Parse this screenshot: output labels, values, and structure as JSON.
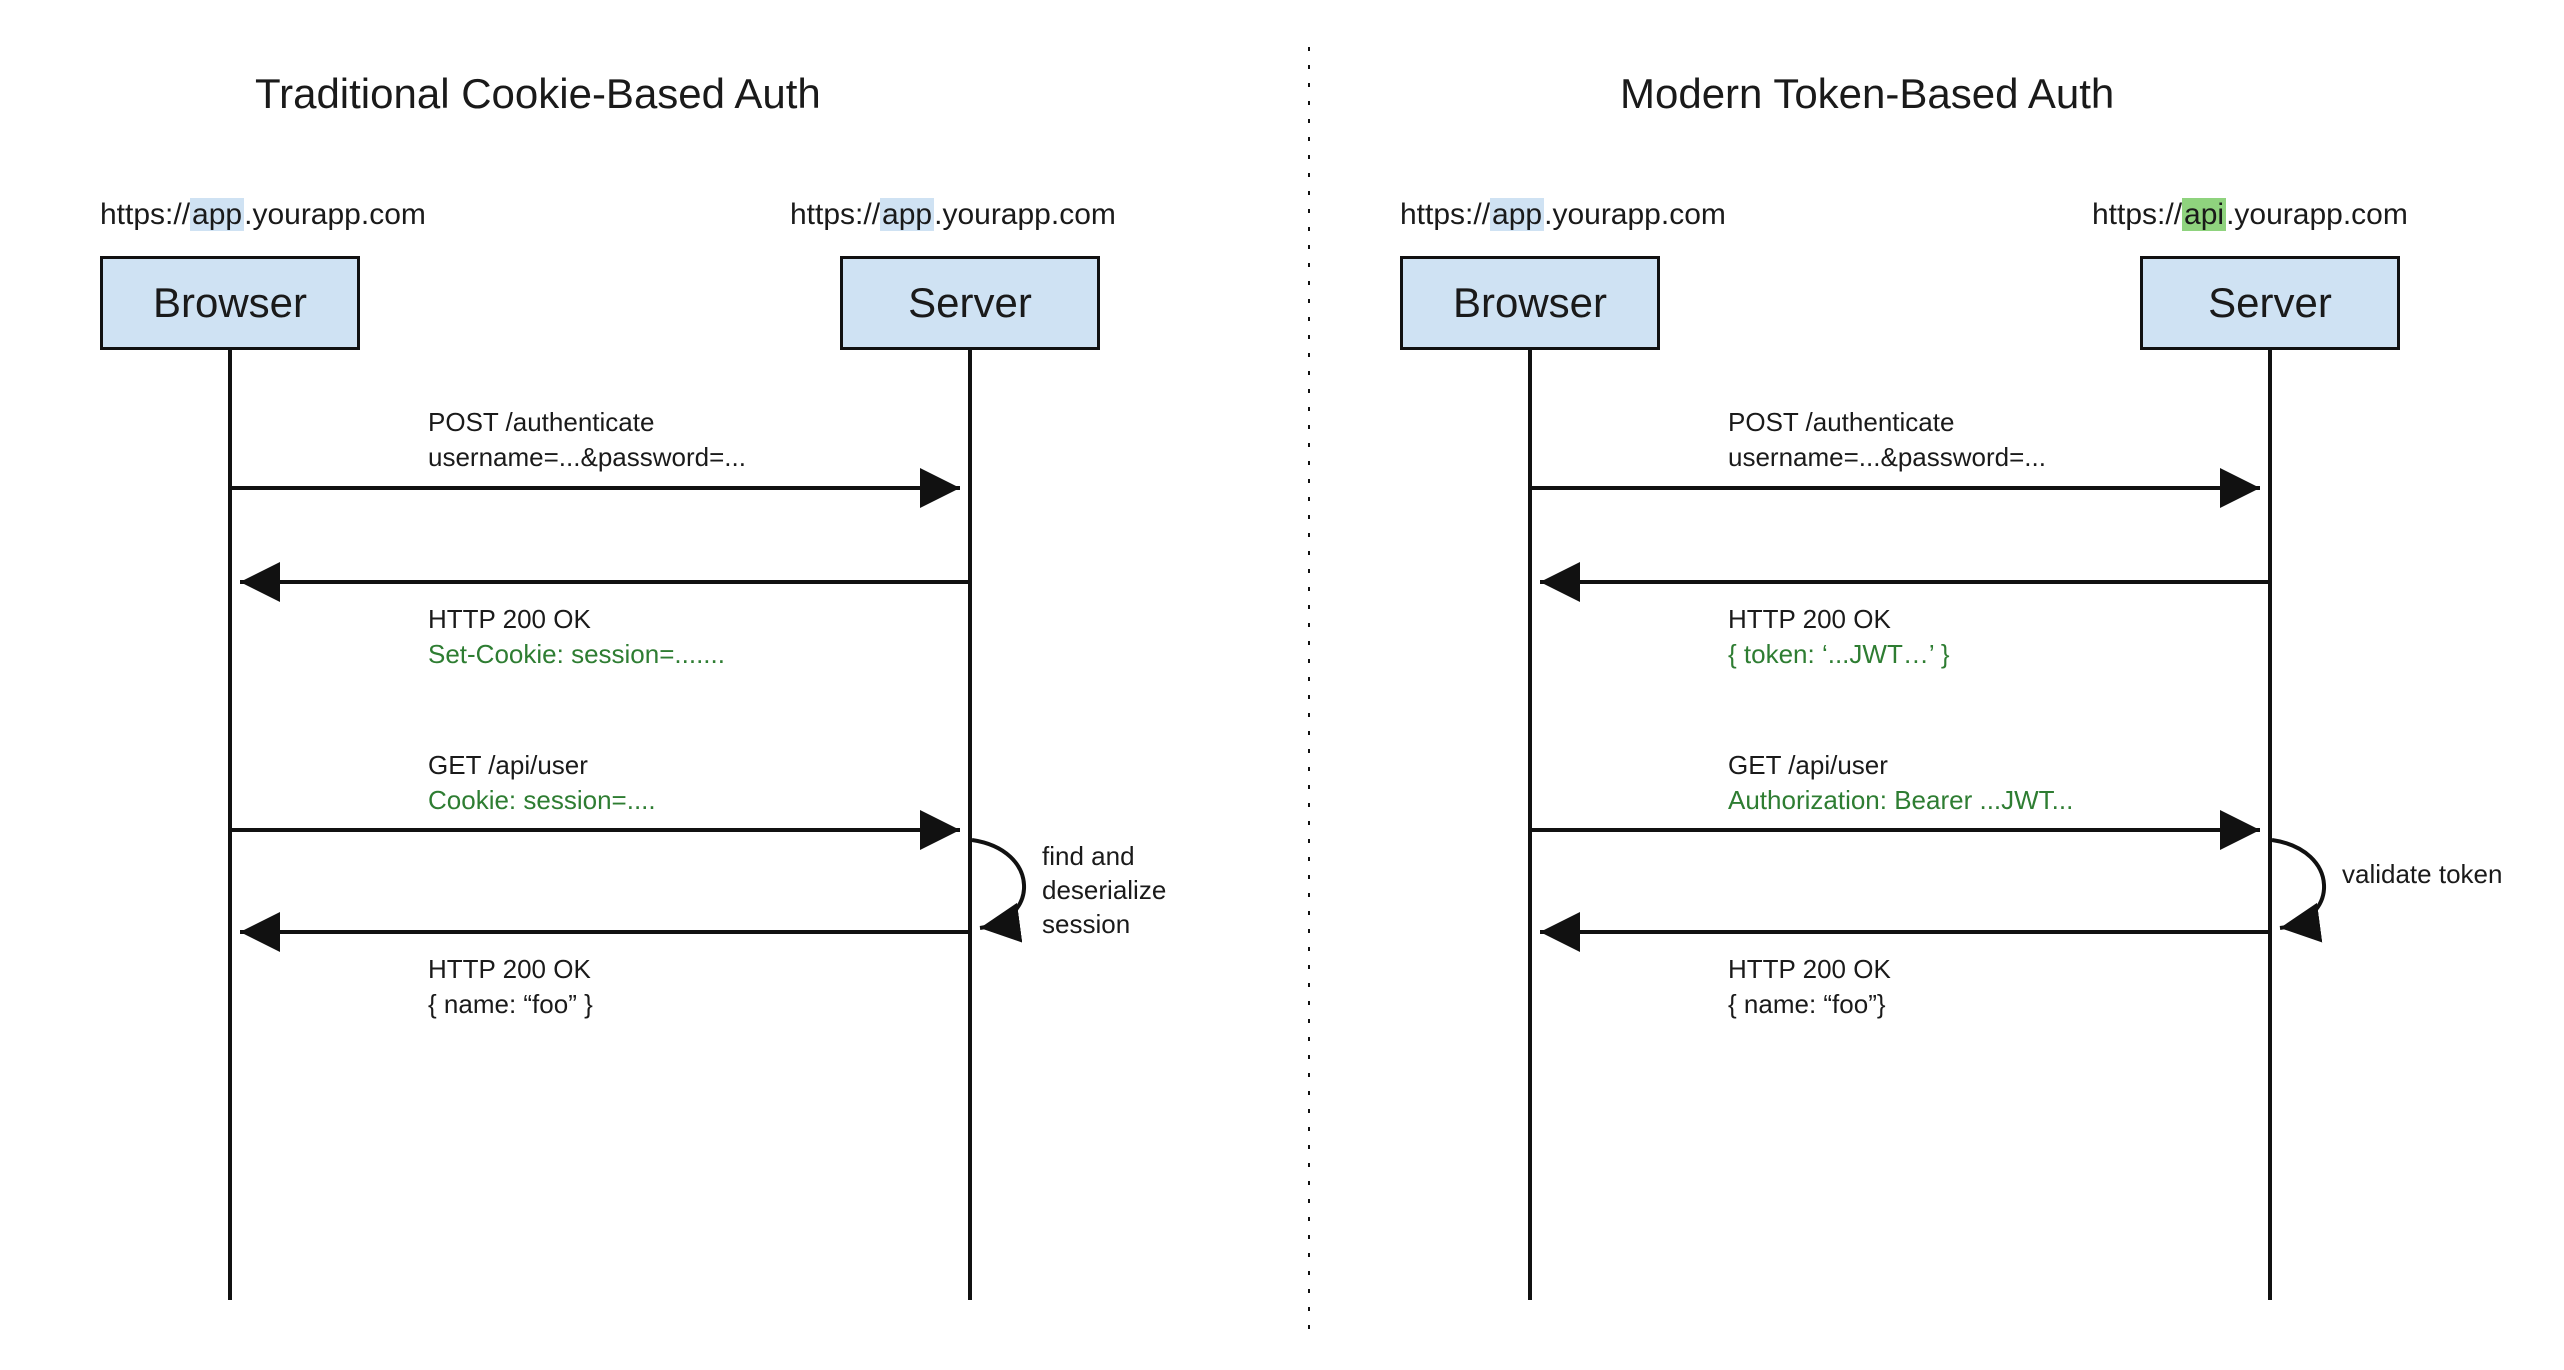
{
  "left": {
    "title": "Traditional Cookie-Based Auth",
    "browser_url_pre": "https://",
    "browser_url_hl": "app",
    "browser_url_post": ".yourapp.com",
    "server_url_pre": "https://",
    "server_url_hl": "app",
    "server_url_post": ".yourapp.com",
    "browser_label": "Browser",
    "server_label": "Server",
    "msg1a": "POST /authenticate",
    "msg1b": "username=...&password=...",
    "msg2a": "HTTP 200 OK",
    "msg2b": "Set-Cookie: session=.......",
    "msg3a": "GET /api/user",
    "msg3b": "Cookie: session=....",
    "self_note_l1": "find and",
    "self_note_l2": "deserialize",
    "self_note_l3": "session",
    "msg4a": "HTTP 200 OK",
    "msg4b": "{  name: “foo” }"
  },
  "right": {
    "title": "Modern Token-Based Auth",
    "browser_url_pre": "https://",
    "browser_url_hl": "app",
    "browser_url_post": ".yourapp.com",
    "server_url_pre": "https://",
    "server_url_hl": "api",
    "server_url_post": ".yourapp.com",
    "browser_label": "Browser",
    "server_label": "Server",
    "msg1a": "POST /authenticate",
    "msg1b": "username=...&password=...",
    "msg2a": "HTTP 200 OK",
    "msg2b": "{ token: ‘...JWT…’ }",
    "msg3a": "GET /api/user",
    "msg3b": "Authorization: Bearer ...JWT...",
    "self_note": "validate token",
    "msg4a": "HTTP 200 OK",
    "msg4b": "{ name: “foo”}"
  },
  "colors": {
    "box_fill": "#cfe2f3",
    "stroke": "#111111",
    "green": "#2e7d32",
    "hl_blue": "#cfe2f3",
    "hl_green": "#8fd37e"
  }
}
